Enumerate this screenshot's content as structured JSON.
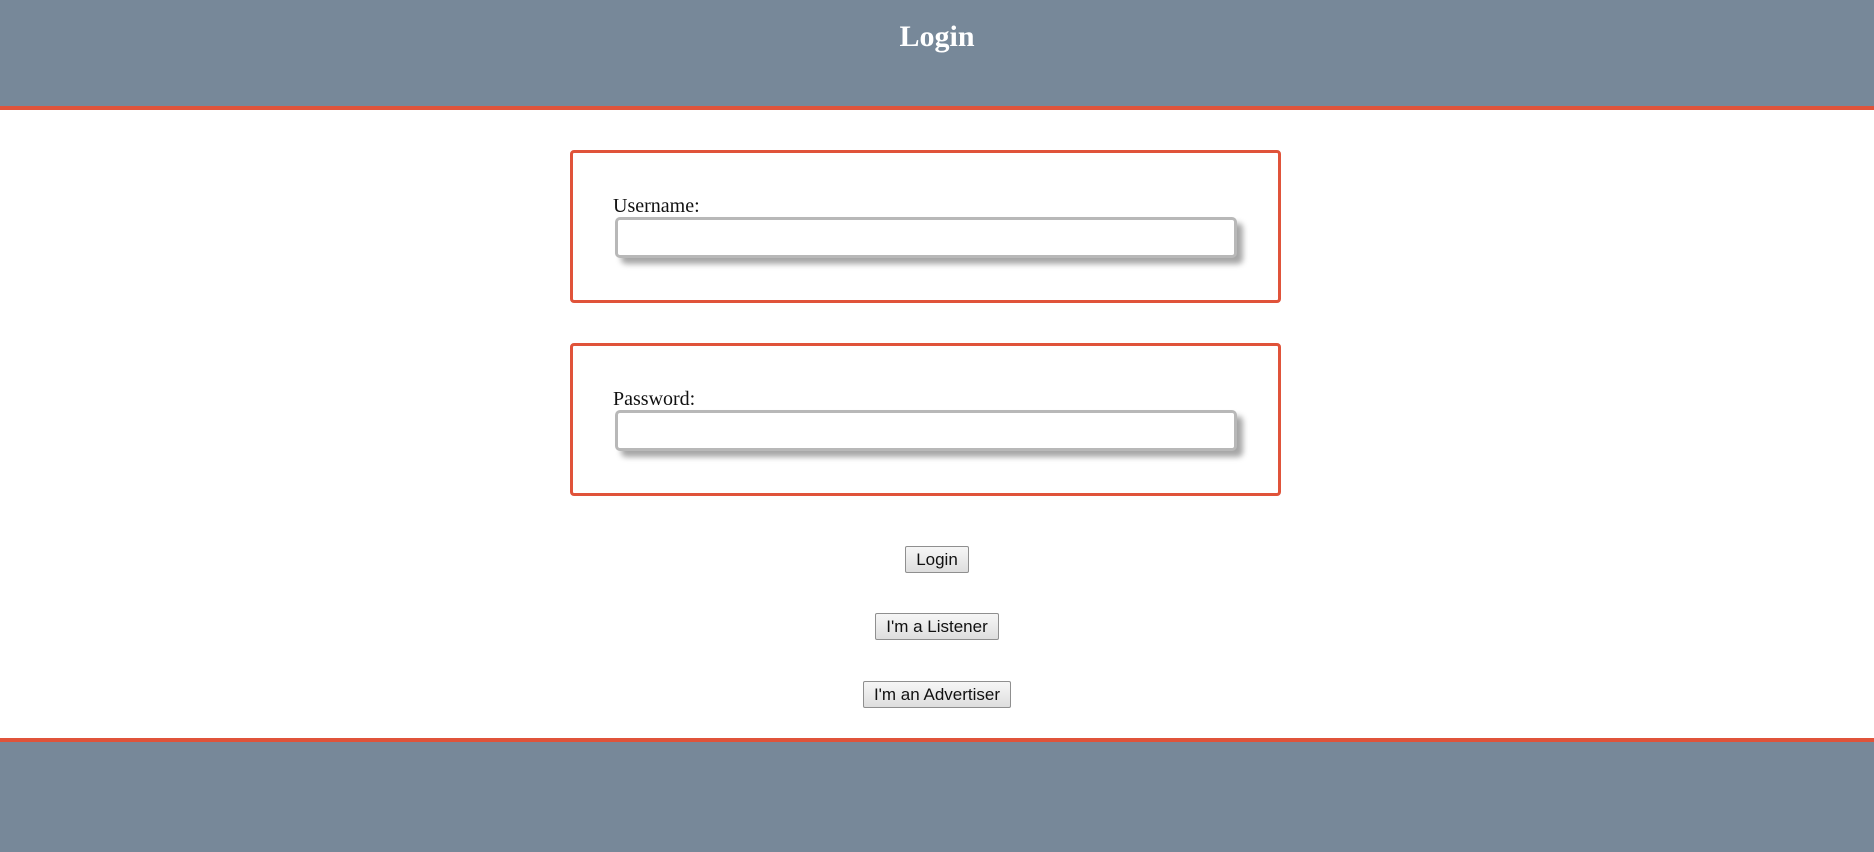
{
  "header": {
    "title": "Login"
  },
  "form": {
    "username": {
      "label": "Username:",
      "value": "",
      "placeholder": ""
    },
    "password": {
      "label": "Password:",
      "value": "",
      "placeholder": ""
    }
  },
  "buttons": {
    "login": "Login",
    "listener": "I'm a Listener",
    "advertiser": "I'm an Advertiser"
  },
  "colors": {
    "header_bg": "#778899",
    "accent_border": "#e0533a",
    "background": "#ffffff"
  }
}
